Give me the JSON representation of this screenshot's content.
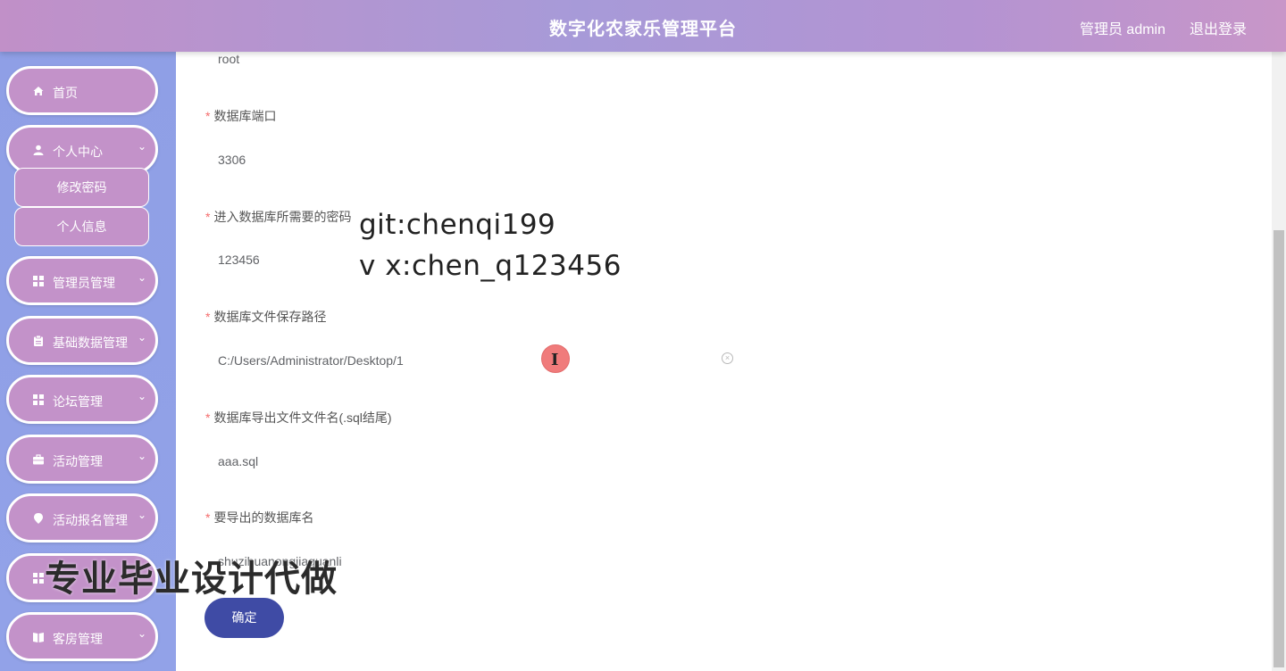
{
  "header": {
    "title": "数字化农家乐管理平台",
    "user": "管理员 admin",
    "logout": "退出登录"
  },
  "sidebar": {
    "items": [
      {
        "label": "首页",
        "icon": "home-icon"
      },
      {
        "label": "个人中心",
        "icon": "user-icon"
      },
      {
        "label": "管理员管理",
        "icon": "grid-icon"
      },
      {
        "label": "基础数据管理",
        "icon": "clipboard-icon"
      },
      {
        "label": "论坛管理",
        "icon": "grid-icon"
      },
      {
        "label": "活动管理",
        "icon": "briefcase-icon"
      },
      {
        "label": "活动报名管理",
        "icon": "location-icon"
      },
      {
        "label": "客房管理",
        "icon": "book-icon"
      }
    ],
    "subitems": [
      {
        "label": "修改密码"
      },
      {
        "label": "个人信息"
      }
    ],
    "chevron": "⌄"
  },
  "form": {
    "fields": [
      {
        "label": "",
        "value": "root"
      },
      {
        "label": "数据库端口",
        "value": "3306"
      },
      {
        "label": "进入数据库所需要的密码",
        "value": "123456"
      },
      {
        "label": "数据库文件保存路径",
        "value": "C:/Users/Administrator/Desktop/1"
      },
      {
        "label": "数据库导出文件文件名(.sql结尾)",
        "value": "aaa.sql"
      },
      {
        "label": "要导出的数据库名",
        "value": "shuzihuanongjiaguanli"
      }
    ],
    "required_mark": "*",
    "confirm": "确定"
  },
  "overlay": {
    "line1": "git:chenqi199",
    "line2": "v x:chen_q123456"
  },
  "watermark": "专业毕业设计代做",
  "cursor_glyph": "I",
  "clear_glyph": "×"
}
